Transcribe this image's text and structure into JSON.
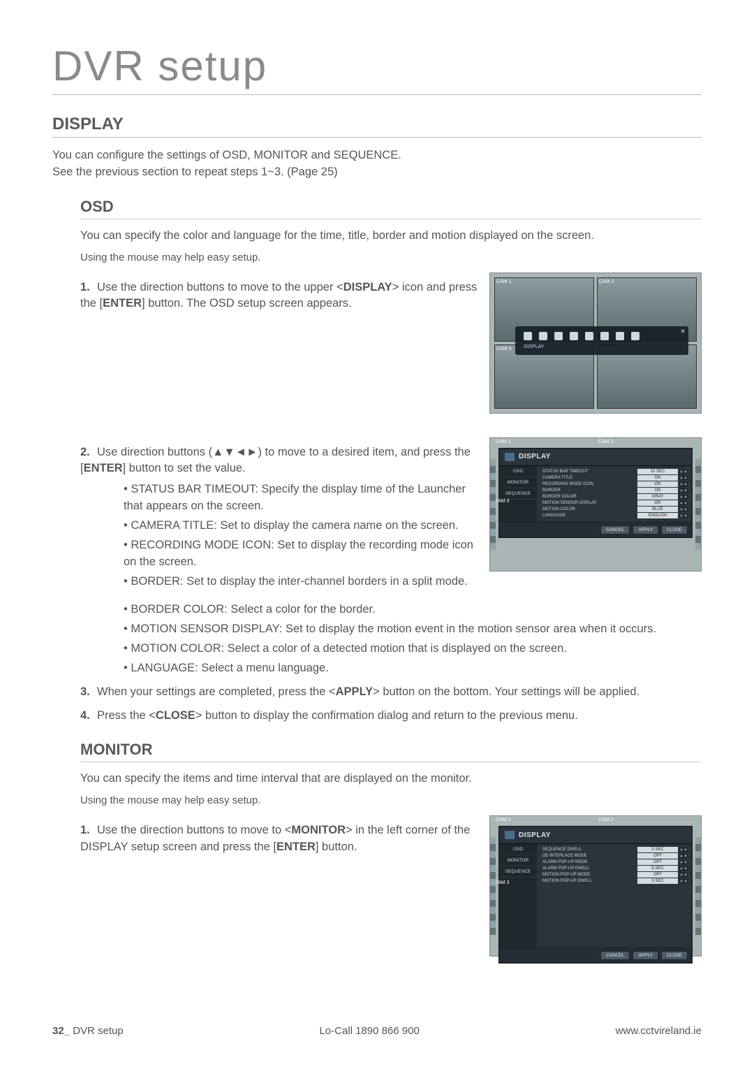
{
  "page_title": "DVR setup",
  "section_display": {
    "heading": "DISPLAY",
    "intro1": "You can configure the settings of OSD, MONITOR and SEQUENCE.",
    "intro2": "See the previous section to repeat steps 1~3. (Page 25)"
  },
  "osd": {
    "heading": "OSD",
    "intro": "You can specify the color and language for the time, title, border and motion displayed on the screen.",
    "note": "Using the mouse may help easy setup.",
    "step1_num": "1.",
    "step1_a": "Use the direction buttons to move to the upper ",
    "step1_b": "<",
    "step1_c": "DISPLAY",
    "step1_d": "> icon and press the [",
    "step1_e": "ENTER",
    "step1_f": "] button. The OSD setup screen appears.",
    "step2_num": "2.",
    "step2_a": "Use direction buttons (▲▼◄►) to move to a desired item, and press the [",
    "step2_b": "ENTER",
    "step2_c": "] button to set the value.",
    "bul1": "STATUS BAR TIMEOUT: Specify the display time of the Launcher that appears on the screen.",
    "bul2": "CAMERA TITLE: Set to display the camera name on the screen.",
    "bul3": "RECORDING MODE ICON: Set to display the recording mode icon on the screen.",
    "bul4": "BORDER: Set to display the inter-channel borders in a split mode.",
    "bul5": "BORDER COLOR: Select a color for the border.",
    "bul6": "MOTION SENSOR DISPLAY: Set to display the motion event in the motion sensor area when it occurs.",
    "bul7": "MOTION COLOR: Select a color of a detected motion that is displayed on the screen.",
    "bul8": "LANGUAGE: Select a menu language.",
    "step3_num": "3.",
    "step3_a": "When your settings are completed, press the <",
    "step3_b": "APPLY",
    "step3_c": "> button on the bottom. Your settings will be applied.",
    "step4_num": "4.",
    "step4_a": "Press the <",
    "step4_b": "CLOSE",
    "step4_c": "> button to display the confirmation dialog and return to the previous menu."
  },
  "monitor": {
    "heading": "MONITOR",
    "intro": "You can specify the items and time interval that are displayed on the monitor.",
    "note": "Using the mouse may help easy setup.",
    "step1_num": "1.",
    "step1_a": "Use the direction buttons to move to <",
    "step1_b": "MONITOR",
    "step1_c": "> in the left corner of the DISPLAY setup screen and press the [",
    "step1_d": "ENTER",
    "step1_e": "] button."
  },
  "cam_labels": {
    "c1": "CAM 1",
    "c2": "CAM 2",
    "c3": "CAM 3",
    "c4": "CAM 4"
  },
  "launcher": {
    "caption": "DISPLAY"
  },
  "dlg_common": {
    "title": "DISPLAY",
    "cancel": "CANCEL",
    "apply": "APPLY",
    "close": "CLOSE"
  },
  "dlg_osd": {
    "side": {
      "osd": "OSD",
      "monitor": "MONITOR",
      "sequence": "SEQUENCE"
    },
    "rows": [
      {
        "k": "STATUS BAR TIMEOUT",
        "v": "10 SEC"
      },
      {
        "k": "CAMERA TITLE",
        "v": "ON"
      },
      {
        "k": "RECORDING MODE ICON",
        "v": "ON"
      },
      {
        "k": "BORDER",
        "v": "ON"
      },
      {
        "k": "BORDER COLOR",
        "v": "GRAY"
      },
      {
        "k": "MOTION SENSOR DISPLAY",
        "v": "ON"
      },
      {
        "k": "MOTION COLOR",
        "v": "BLUE"
      },
      {
        "k": "LANGUAGE",
        "v": "ENGLISH"
      }
    ]
  },
  "dlg_mon": {
    "side": {
      "osd": "OSD",
      "monitor": "MONITOR",
      "sequence": "SEQUENCE"
    },
    "rows": [
      {
        "k": "SEQUENCE DWELL",
        "v": "5 SEC"
      },
      {
        "k": "DE-INTERLACE MODE",
        "v": "OFF"
      },
      {
        "k": "ALARM POP-UP MODE",
        "v": "OFF"
      },
      {
        "k": "ALARM POP-UP DWELL",
        "v": "5 SEC"
      },
      {
        "k": "MOTION POP-UP MODE",
        "v": "OFF"
      },
      {
        "k": "MOTION POP-UP DWELL",
        "v": "5 SEC"
      }
    ]
  },
  "footer": {
    "page_num": "32_",
    "page_label": " DVR setup",
    "phone": "Lo-Call  1890 866 900",
    "url": "www.cctvireland.ie"
  }
}
